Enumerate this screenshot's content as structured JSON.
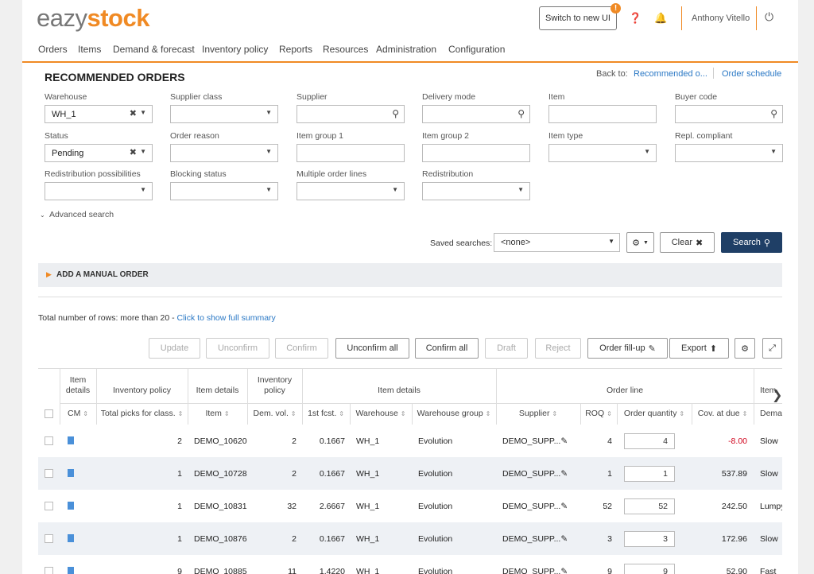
{
  "app": {
    "logo_part1": "eazy",
    "logo_part2": "stock",
    "switch_label": "Switch to new UI",
    "badge": "!",
    "user": "Anthony Vitello"
  },
  "nav": [
    "Orders",
    "Items",
    "Demand & forecast",
    "Inventory policy",
    "Reports",
    "Resources",
    "Administration",
    "Configuration"
  ],
  "page": {
    "title": "RECOMMENDED ORDERS",
    "back_to": "Back to:",
    "back_link1": "Recommended o...",
    "back_link2": "Order schedule"
  },
  "filters": {
    "warehouse": {
      "label": "Warehouse",
      "value": "WH_1"
    },
    "supplier_class": {
      "label": "Supplier class",
      "value": ""
    },
    "supplier": {
      "label": "Supplier",
      "value": ""
    },
    "delivery_mode": {
      "label": "Delivery mode",
      "value": ""
    },
    "item": {
      "label": "Item",
      "value": ""
    },
    "buyer_code": {
      "label": "Buyer code",
      "value": ""
    },
    "status": {
      "label": "Status",
      "value": "Pending"
    },
    "order_reason": {
      "label": "Order reason",
      "value": ""
    },
    "item_group1": {
      "label": "Item group 1",
      "value": ""
    },
    "item_group2": {
      "label": "Item group 2",
      "value": ""
    },
    "item_type": {
      "label": "Item type",
      "value": ""
    },
    "repl_compliant": {
      "label": "Repl. compliant",
      "value": ""
    },
    "redistribution_possibilities": {
      "label": "Redistribution possibilities",
      "value": ""
    },
    "blocking_status": {
      "label": "Blocking status",
      "value": ""
    },
    "multiple_order_lines": {
      "label": "Multiple order lines",
      "value": ""
    },
    "redistribution": {
      "label": "Redistribution",
      "value": ""
    }
  },
  "advanced_search": "Advanced search",
  "saved": {
    "label": "Saved searches:",
    "value": "<none>"
  },
  "buttons": {
    "clear": "Clear",
    "search": "Search",
    "update": "Update",
    "unconfirm": "Unconfirm",
    "confirm": "Confirm",
    "unconfirm_all": "Unconfirm all",
    "confirm_all": "Confirm all",
    "draft": "Draft",
    "reject": "Reject",
    "order_fillup": "Order fill-up",
    "export": "Export"
  },
  "manual_order": "ADD A MANUAL ORDER",
  "total": {
    "text": "Total number of rows: more than 20 - ",
    "link": "Click to show full summary"
  },
  "table": {
    "groups": {
      "item_details_a": "Item details",
      "inventory_policy": "Inventory policy",
      "item_details_b": "Item details",
      "inventory_policy_b": "Inventory policy",
      "item_details_c": "Item details",
      "order_line": "Order line",
      "item_cut": "Item"
    },
    "columns": {
      "cm": "CM",
      "total_picks": "Total picks for class.",
      "item": "Item",
      "dem_vol": "Dem. vol.",
      "first_fcst": "1st fcst.",
      "warehouse": "Warehouse",
      "warehouse_group": "Warehouse group",
      "supplier": "Supplier",
      "roq": "ROQ",
      "order_qty": "Order quantity",
      "cov_due": "Cov. at due",
      "demand_cut": "Dema"
    },
    "rows": [
      {
        "picks": "2",
        "item": "DEMO_10620",
        "dem_vol": "2",
        "fcst": "0.1667",
        "wh": "WH_1",
        "wg": "Evolution",
        "supplier": "DEMO_SUPP...",
        "roq": "4",
        "qty": "4",
        "cov": "-8.00",
        "dem": "Slow"
      },
      {
        "picks": "1",
        "item": "DEMO_10728",
        "dem_vol": "2",
        "fcst": "0.1667",
        "wh": "WH_1",
        "wg": "Evolution",
        "supplier": "DEMO_SUPP...",
        "roq": "1",
        "qty": "1",
        "cov": "537.89",
        "dem": "Slow"
      },
      {
        "picks": "1",
        "item": "DEMO_10831",
        "dem_vol": "32",
        "fcst": "2.6667",
        "wh": "WH_1",
        "wg": "Evolution",
        "supplier": "DEMO_SUPP...",
        "roq": "52",
        "qty": "52",
        "cov": "242.50",
        "dem": "Lumpy"
      },
      {
        "picks": "1",
        "item": "DEMO_10876",
        "dem_vol": "2",
        "fcst": "0.1667",
        "wh": "WH_1",
        "wg": "Evolution",
        "supplier": "DEMO_SUPP...",
        "roq": "3",
        "qty": "3",
        "cov": "172.96",
        "dem": "Slow"
      },
      {
        "picks": "9",
        "item": "DEMO_10885",
        "dem_vol": "11",
        "fcst": "1.4220",
        "wh": "WH_1",
        "wg": "Evolution",
        "supplier": "DEMO_SUPP...",
        "roq": "9",
        "qty": "9",
        "cov": "52.90",
        "dem": "Fast"
      }
    ]
  }
}
